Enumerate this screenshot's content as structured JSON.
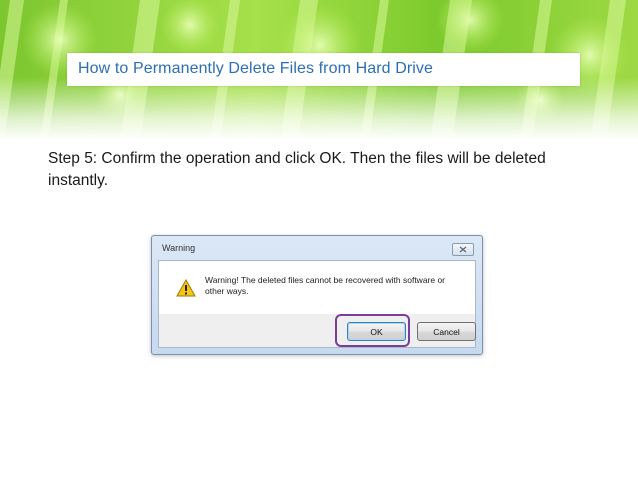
{
  "slide": {
    "title": "How to Permanently Delete Files from Hard Drive",
    "step_text": "Step 5: Confirm the operation and click OK. Then the files will be deleted instantly."
  },
  "dialog": {
    "title": "Warning",
    "message": "Warning! The deleted files cannot be recovered with software or other ways.",
    "ok_label": "OK",
    "cancel_label": "Cancel",
    "icon": "warning-triangle-icon",
    "close_icon": "close-icon"
  },
  "colors": {
    "title_text": "#2d6fb1",
    "banner_green": "#8fd13a",
    "highlight": "#7a3d9a"
  }
}
